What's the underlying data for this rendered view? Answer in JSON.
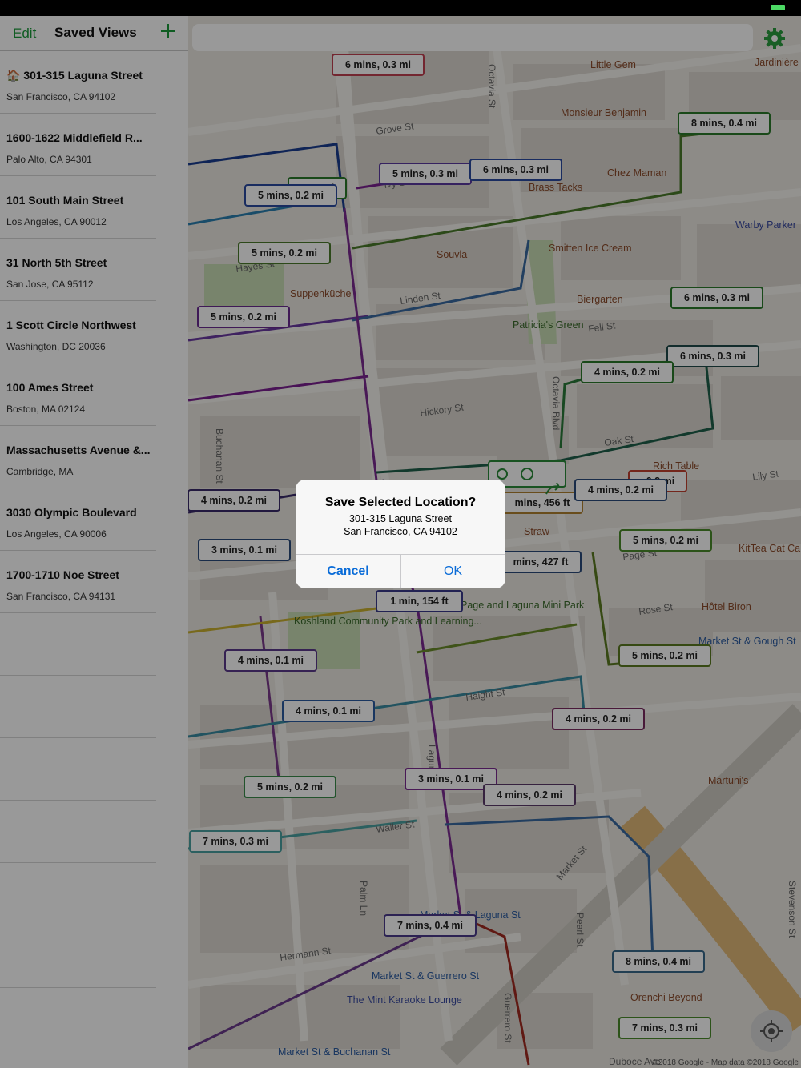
{
  "sidebar": {
    "edit_label": "Edit",
    "title": "Saved Views",
    "add_icon": "plus-icon",
    "items": [
      {
        "title": "🏠 301-315 Laguna Street",
        "subtitle": "San Francisco, CA 94102"
      },
      {
        "title": "1600-1622 Middlefield R...",
        "subtitle": "Palo Alto, CA 94301"
      },
      {
        "title": "101 South Main Street",
        "subtitle": "Los Angeles, CA 90012"
      },
      {
        "title": "31 North 5th Street",
        "subtitle": "San Jose, CA 95112"
      },
      {
        "title": "1 Scott Circle Northwest",
        "subtitle": "Washington, DC 20036"
      },
      {
        "title": "100 Ames Street",
        "subtitle": "Boston, MA 02124"
      },
      {
        "title": "Massachusetts Avenue &...",
        "subtitle": "Cambridge, MA"
      },
      {
        "title": "3030 Olympic Boulevard",
        "subtitle": "Los Angeles, CA 90006"
      },
      {
        "title": "1700-1710 Noe Street",
        "subtitle": "San Francisco, CA 94131"
      }
    ]
  },
  "settings_icon": "gear-icon",
  "locate_icon": "location-target-icon",
  "dialog": {
    "title": "Save Selected Location?",
    "line1": "301-315 Laguna Street",
    "line2": "San Francisco, CA 94102",
    "cancel_label": "Cancel",
    "ok_label": "OK"
  },
  "map": {
    "street_labels": [
      "Grove St",
      "Hayes St",
      "Linden St",
      "Fell St",
      "Hickory St",
      "Oak St",
      "Lily St",
      "Page St",
      "Rose St",
      "Haight St",
      "Waller St",
      "Hermann St",
      "Market St",
      "Octavia Blvd",
      "Octavia St",
      "Buchanan St",
      "Laguna St",
      "Palm Ln",
      "Pearl St",
      "Guerrero St",
      "Stevenson St",
      "Ivy St",
      "Duboce Ave"
    ],
    "poi_labels": [
      "Little Gem",
      "Jardinière",
      "Monsieur Benjamin",
      "Chez Maman",
      "Brass Tacks",
      "Smitten Ice Cream",
      "Souvla",
      "Suppenküche",
      "Biergarten",
      "Warby Parker",
      "Rich Table",
      "Straw",
      "KitTea Cat Ca",
      "Hôtel Biron",
      "Martuni's",
      "Orenchi Beyond",
      "The Mint Karaoke Lounge",
      "Koshland Community Park and Learning...",
      "Patricia's Green",
      "Page and Laguna Mini Park",
      "Market St & Gough St",
      "Market St & Laguna St",
      "Market St & Guerrero St",
      "Market St & Buchanan St"
    ],
    "route_labels": [
      "6 mins, 0.3 mi",
      "8 mins, 0.4 mi",
      "5 mins, 0.3 mi",
      "6 mins, 0.3 mi",
      ", 0.2 mi",
      "5 mins, 0.2 mi",
      "5 mins, 0.2 mi",
      "6 mins, 0.3 mi",
      "5 mins, 0.2 mi",
      "6 mins, 0.3 mi",
      "4 mins, 0.2 mi",
      "4 mins, 0.2 mi",
      ", 0.2 mi",
      "mins, 456 ft",
      "4 mins, 0.2 mi",
      "3 mins, 0.1 mi",
      "mins, 427 ft",
      "1 min, 154 ft",
      "4 mins, 0.1 mi",
      "5 mins, 0.2 mi",
      "4 mins, 0.1 mi",
      "4 mins, 0.2 mi",
      "5 mins, 0.2 mi",
      "3 mins, 0.1 mi",
      "4 mins, 0.2 mi",
      "7 mins, 0.3 mi",
      "5 mins, 0.2 mi",
      "7 mins, 0.4 mi",
      "8 mins, 0.4 mi",
      "7 mins, 0.3 mi"
    ],
    "attribution": "©2018 Google - Map data ©2018 Google"
  }
}
